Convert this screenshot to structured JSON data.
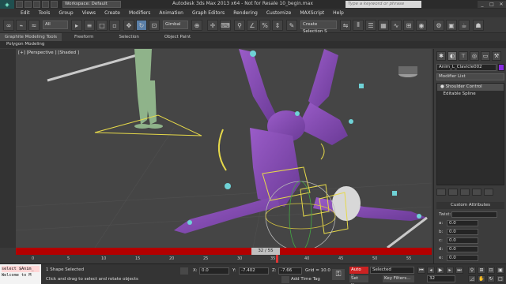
{
  "titlebar": {
    "workspace": "Workspace: Default",
    "title": "Autodesk 3ds Max  2013 x64  - Not for Resale   10_begin.max",
    "search_placeholder": "Type a keyword or phrase",
    "controls": [
      "_",
      "□",
      "✕"
    ]
  },
  "menu": [
    "Edit",
    "Tools",
    "Group",
    "Views",
    "Create",
    "Modifiers",
    "Animation",
    "Graph Editors",
    "Rendering",
    "Customize",
    "MAXScript",
    "Help"
  ],
  "toolbar": {
    "filter": "All",
    "ref_coord": "Gimbal",
    "selection_set": "Create Selection S"
  },
  "ribbon": {
    "tabs": [
      "Graphite Modeling Tools",
      "Freeform",
      "Selection",
      "Object Paint"
    ],
    "sub_label": "Polygon Modeling"
  },
  "viewport": {
    "label": "[+] [Perspective ] [Shaded ]"
  },
  "command_panel": {
    "object_name": "Anim_L_Clavicle002",
    "object_color": "#8a2be2",
    "modifier_list": "Modifier List",
    "stack": [
      "Shoulder Control",
      "Editable Spline"
    ],
    "custom_attributes_title": "Custom Attributes",
    "attrs": [
      {
        "label": "Twist:",
        "value": ""
      },
      {
        "label": "a:",
        "value": "0.0"
      },
      {
        "label": "b:",
        "value": "0.0"
      },
      {
        "label": "c:",
        "value": "0.0"
      },
      {
        "label": "d:",
        "value": "0.0"
      },
      {
        "label": "e:",
        "value": "0.0"
      }
    ]
  },
  "timeline": {
    "frame_indicator": "32 / 55",
    "ticks": [
      "0",
      "5",
      "10",
      "15",
      "20",
      "25",
      "30",
      "35",
      "40",
      "45",
      "50",
      "55"
    ]
  },
  "status": {
    "listener_lines": [
      "select $Anim_",
      "Welcome to M"
    ],
    "selection": "1 Shape Selected",
    "prompt": "Click and drag to select and rotate objects",
    "x_label": "X:",
    "x_value": "0.0",
    "y_label": "Y:",
    "y_value": "-7.402",
    "z_label": "Z:",
    "z_value": "-7.66",
    "grid": "Grid = 10.0",
    "add_time_tag": "Add Time Tag",
    "auto_key": "Auto Key",
    "set_key": "Set Key",
    "selected_dropdown": "Selected",
    "key_filters": "Key Filters...",
    "frame": "32"
  },
  "colors": {
    "accent_character": "#7b4fa8",
    "timeline_red": "#b30000",
    "selection_yellow": "#e6d94a",
    "helper_green": "#8fb38a"
  }
}
